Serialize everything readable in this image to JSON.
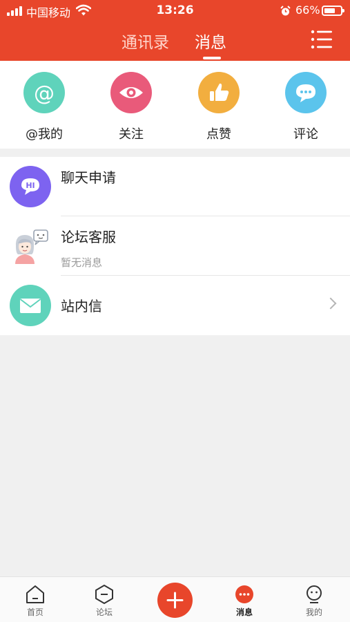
{
  "status_bar": {
    "carrier": "中国移动",
    "time": "13:26",
    "battery": "66%",
    "battery_level": 0.66
  },
  "header": {
    "tabs": [
      {
        "label": "通讯录"
      },
      {
        "label": "消息"
      }
    ],
    "active_tab": "消息",
    "menu_icon": "list-menu-icon"
  },
  "quick_actions": [
    {
      "label": "@我的",
      "icon": "at-icon",
      "color": "#5fd3bb"
    },
    {
      "label": "关注",
      "icon": "eye-icon",
      "color": "#e95a7a"
    },
    {
      "label": "点赞",
      "icon": "thumbs-up-icon",
      "color": "#f2ae3f"
    },
    {
      "label": "评论",
      "icon": "comment-icon",
      "color": "#5bc4ec"
    }
  ],
  "messages": [
    {
      "title": "聊天申请",
      "subtitle": "",
      "icon": "hi-chat-icon",
      "color": "#7d63f0",
      "avatar_text": "HI"
    },
    {
      "title": "论坛客服",
      "subtitle": "暂无消息",
      "icon": "support-agent-icon",
      "color": ""
    },
    {
      "title": "站内信",
      "subtitle": "",
      "icon": "mail-icon",
      "color": "#5fd3bb",
      "has_arrow": true
    }
  ],
  "bottom_nav": [
    {
      "label": "首页",
      "icon": "home-icon",
      "active": false
    },
    {
      "label": "论坛",
      "icon": "forum-icon",
      "active": false
    },
    {
      "label": "",
      "icon": "plus-icon",
      "accent": "#e8462b"
    },
    {
      "label": "消息",
      "icon": "message-icon",
      "active": true
    },
    {
      "label": "我的",
      "icon": "profile-icon",
      "active": false
    }
  ],
  "colors": {
    "brand": "#e8462b",
    "background": "#f0f0f0"
  }
}
